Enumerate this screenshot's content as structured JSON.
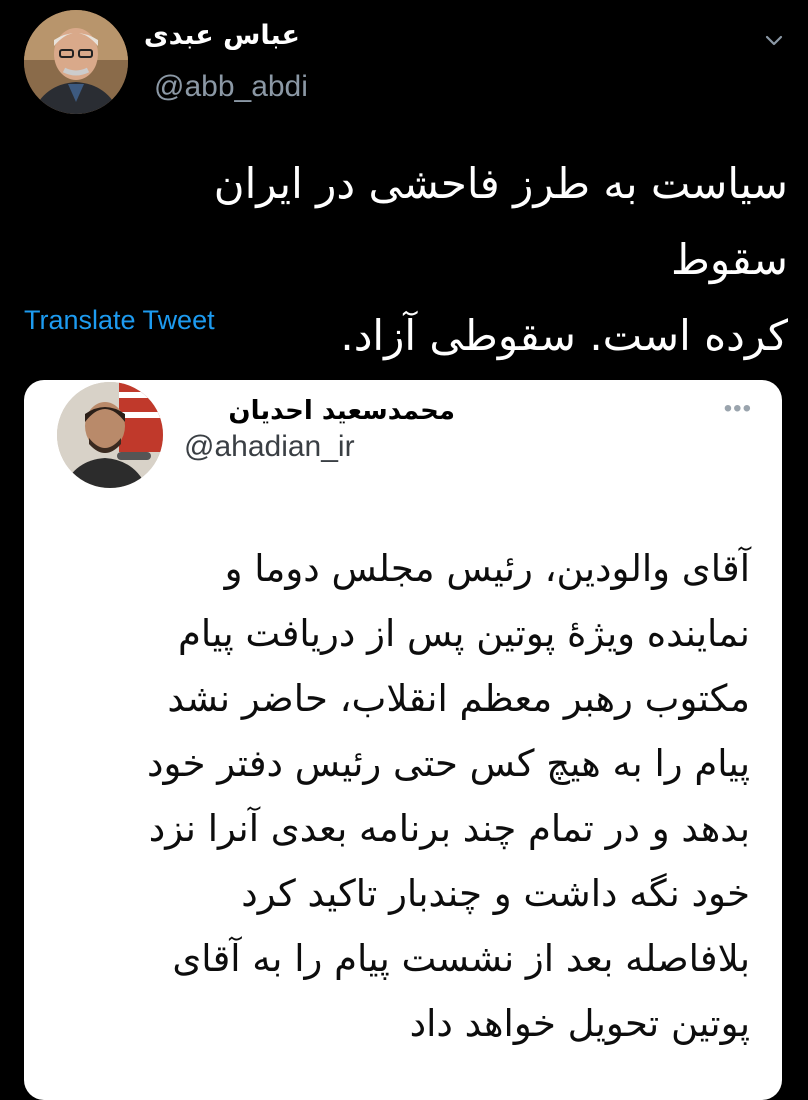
{
  "tweet": {
    "author_name": "عباس عبدی",
    "handle": "@abb_abdi",
    "text_lines": [
      "سیاست به طرز فاحشی در ایران سقوط",
      "کرده است. سقوطی آزاد."
    ],
    "translate_label": "Translate Tweet",
    "menu_icon": "chevron-down-icon"
  },
  "quoted": {
    "author_name": "محمدسعید احدیان",
    "handle": "@ahadian_ir",
    "more_label": "•••",
    "text_lines": [
      "آقای والودین، رئیس مجلس دوما و",
      "نماینده ویژۀ پوتین پس از دریافت پیام",
      "مکتوب رهبر معظم انقلاب، حاضر نشد",
      "پیام را به هیچ کس حتی رئیس دفتر خود",
      "بدهد و در تمام چند برنامه  بعدی آنرا نزد",
      "خود نگه داشت و چندبار تاکید کرد",
      "بلافاصله بعد از نشست پیام را به آقای",
      "پوتین تحویل خواهد داد"
    ]
  }
}
